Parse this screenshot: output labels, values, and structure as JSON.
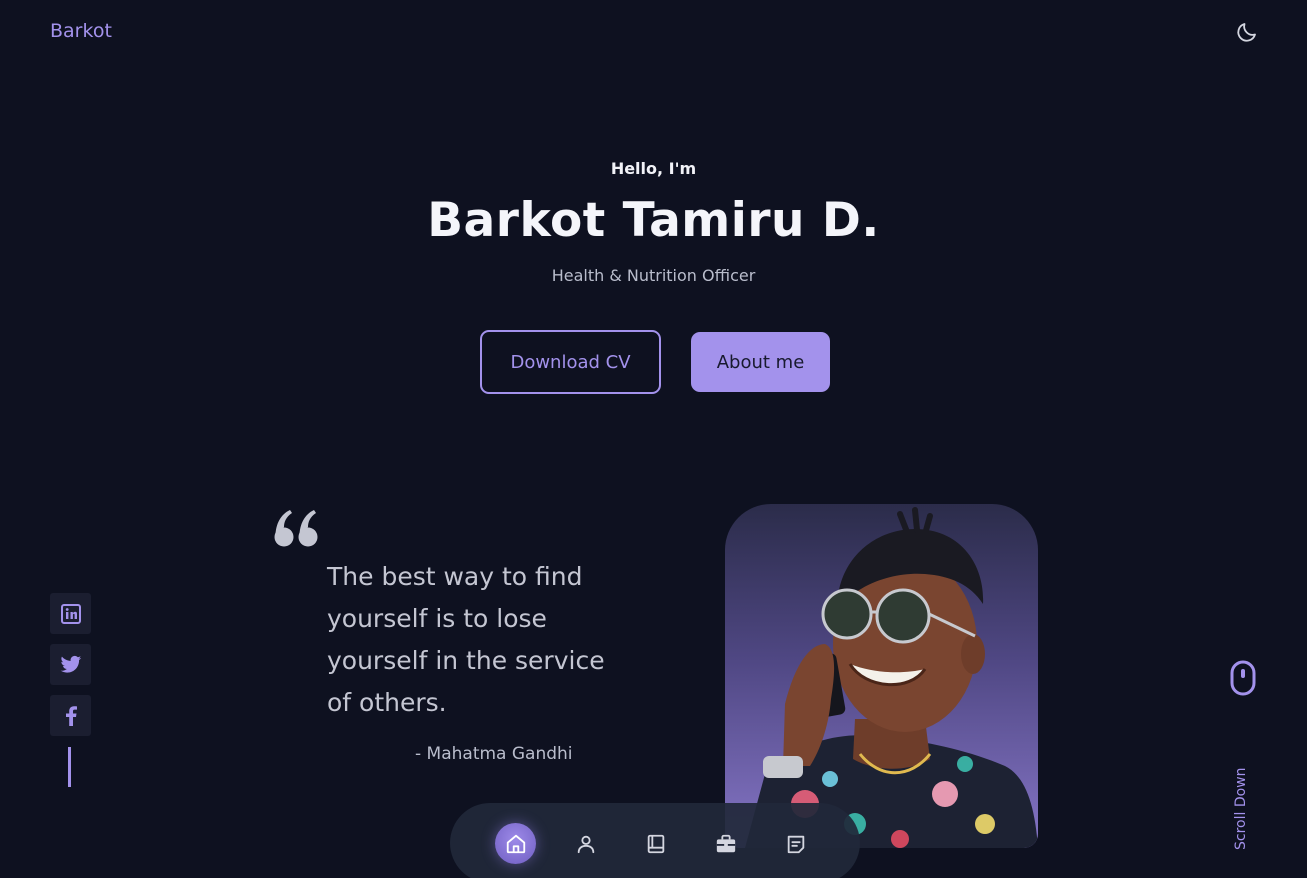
{
  "header": {
    "logo": "Barkot",
    "theme_toggle_icon": "moon-icon"
  },
  "hero": {
    "greeting": "Hello, I'm",
    "name": "Barkot Tamiru D.",
    "role": "Health & Nutrition Officer",
    "download_cv_label": "Download CV",
    "about_me_label": "About me"
  },
  "quote": {
    "icon": "quote-icon",
    "text": "The best way to find yourself is to lose yourself in the service of others.",
    "author": "- Mahatma Gandhi"
  },
  "profile_photo": {
    "alt": "Barkot Tamiru D."
  },
  "social": [
    {
      "icon": "linkedin-icon"
    },
    {
      "icon": "twitter-icon"
    },
    {
      "icon": "facebook-icon"
    }
  ],
  "scroll": {
    "icon": "mouse-icon",
    "label": "Scroll Down"
  },
  "nav": [
    {
      "icon": "home-icon",
      "active": true
    },
    {
      "icon": "user-icon",
      "active": false
    },
    {
      "icon": "book-icon",
      "active": false
    },
    {
      "icon": "briefcase-icon",
      "active": false
    },
    {
      "icon": "message-icon",
      "active": false
    }
  ],
  "colors": {
    "background": "#0e1120",
    "accent": "#a392ec",
    "text": "#f4f5fa",
    "muted": "#b9bdcc",
    "nav_bg": "#21283a"
  }
}
